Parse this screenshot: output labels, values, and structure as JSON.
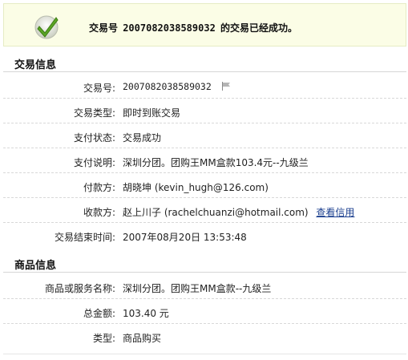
{
  "banner": {
    "prefix": "交易号",
    "trade_no": "2007082038589032",
    "suffix": "的交易已经成功。"
  },
  "sections": {
    "trade_info_title": "交易信息",
    "goods_info_title": "商品信息"
  },
  "trade_rows": {
    "trade_no_label": "交易号:",
    "trade_no_value": "2007082038589032",
    "type_label": "交易类型:",
    "type_value": "即时到账交易",
    "status_label": "支付状态:",
    "status_value": "交易成功",
    "desc_label": "支付说明:",
    "desc_value": "深圳分团。团购王MM盒款103.4元--九级兰",
    "payer_label": "付款方:",
    "payer_value": "胡晓坤 (kevin_hugh@126.com)",
    "payee_label": "收款方:",
    "payee_value": "赵上川子 (rachelchuanzi@hotmail.com)",
    "payee_link": "查看信用",
    "end_time_label": "交易结束时间:",
    "end_time_value": "2007年08月20日 13:53:48"
  },
  "goods_rows": {
    "name_label": "商品或服务名称:",
    "name_value": "深圳分团。团购王MM盒款--九级兰",
    "amount_label": "总金额:",
    "amount_value": "103.40 元",
    "kind_label": "类型:",
    "kind_value": "商品购买"
  },
  "colors": {
    "banner_bg": "#fbfde6",
    "check_green": "#5aa425",
    "link": "#1b3f8f"
  },
  "icons": {
    "success": "check-icon",
    "flag": "flag-icon"
  }
}
